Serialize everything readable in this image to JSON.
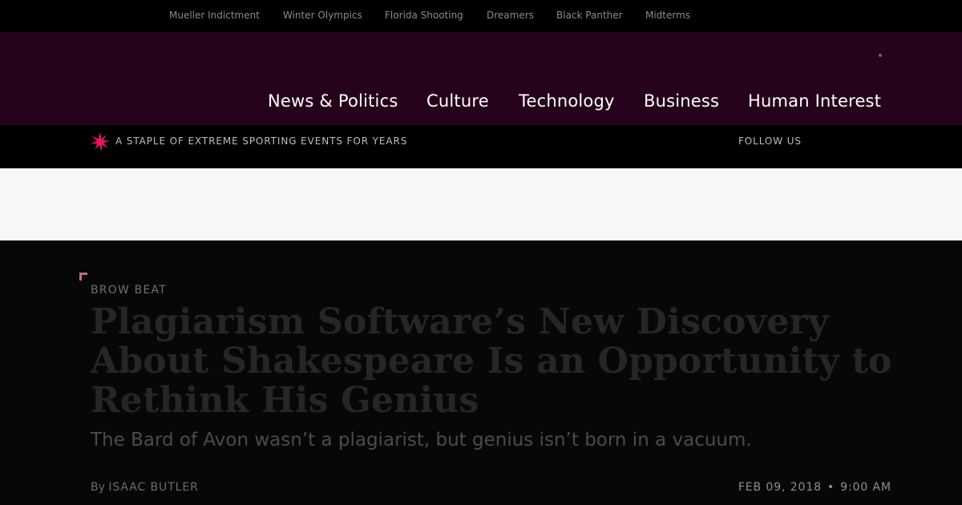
{
  "trending": {
    "items": [
      "Mueller Indictment",
      "Winter Olympics",
      "Florida Shooting",
      "Dreamers",
      "Black Panther",
      "Midterms"
    ]
  },
  "nav": {
    "items": [
      "News & Politics",
      "Culture",
      "Technology",
      "Business",
      "Human Interest"
    ]
  },
  "subbar": {
    "tagline": "A STAPLE OF EXTREME SPORTING EVENTS FOR YEARS",
    "follow": "FOLLOW US",
    "logo_icon": "slate-asterisk-logo-icon"
  },
  "article": {
    "kicker": "BROW BEAT",
    "headline": "Plagiarism Software’s New Discovery About Shakespeare Is an Opportunity to Rethink His Genius",
    "dek": "The Bard of Avon wasn’t a plagiarist, but genius isn’t born in a vacuum.",
    "byline_prefix": "By",
    "author": "ISAAC BUTLER",
    "date": "FEB 09, 2018",
    "separator": "•",
    "time": "9:00 AM"
  },
  "colors": {
    "nav_band": "#26031c",
    "logo_accent": "#e8175d",
    "corner_mark": "#c0689a"
  }
}
